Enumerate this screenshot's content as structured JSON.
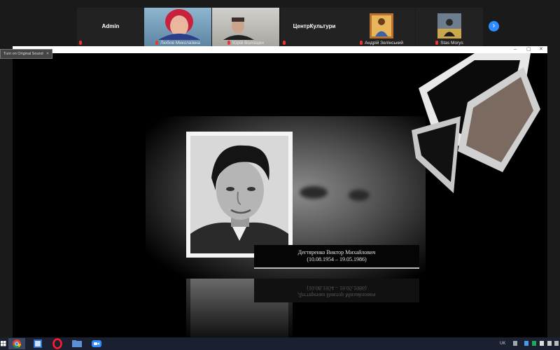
{
  "gallery": {
    "tiles": [
      {
        "name": "Admin",
        "caption": ""
      },
      {
        "name": "",
        "caption": "Любов Миколаївна"
      },
      {
        "name": "",
        "caption": "Юрій Волощин"
      },
      {
        "name": "ЦентрКультури",
        "caption": ""
      },
      {
        "name": "",
        "caption": "Андрій Зелінський"
      },
      {
        "name": "",
        "caption": "Stas Morys"
      }
    ],
    "next_icon": "›"
  },
  "share_window": {
    "tooltip": "Turn on Original Sound",
    "tooltip_close": "✕",
    "controls": [
      "–",
      "▢",
      "✕"
    ]
  },
  "slide": {
    "name": "Дегтяренко Виктор Михайлович",
    "dates": "(10.08.1954 – 19.05.1986)"
  },
  "taskbar": {
    "apps": [
      "start",
      "chrome",
      "file-explorer",
      "opera",
      "explorer",
      "zoom"
    ],
    "lang": "UK"
  },
  "colors": {
    "zoom_blue": "#2d8cff",
    "mic_muted": "#e33",
    "taskbar": "#1b2030"
  }
}
